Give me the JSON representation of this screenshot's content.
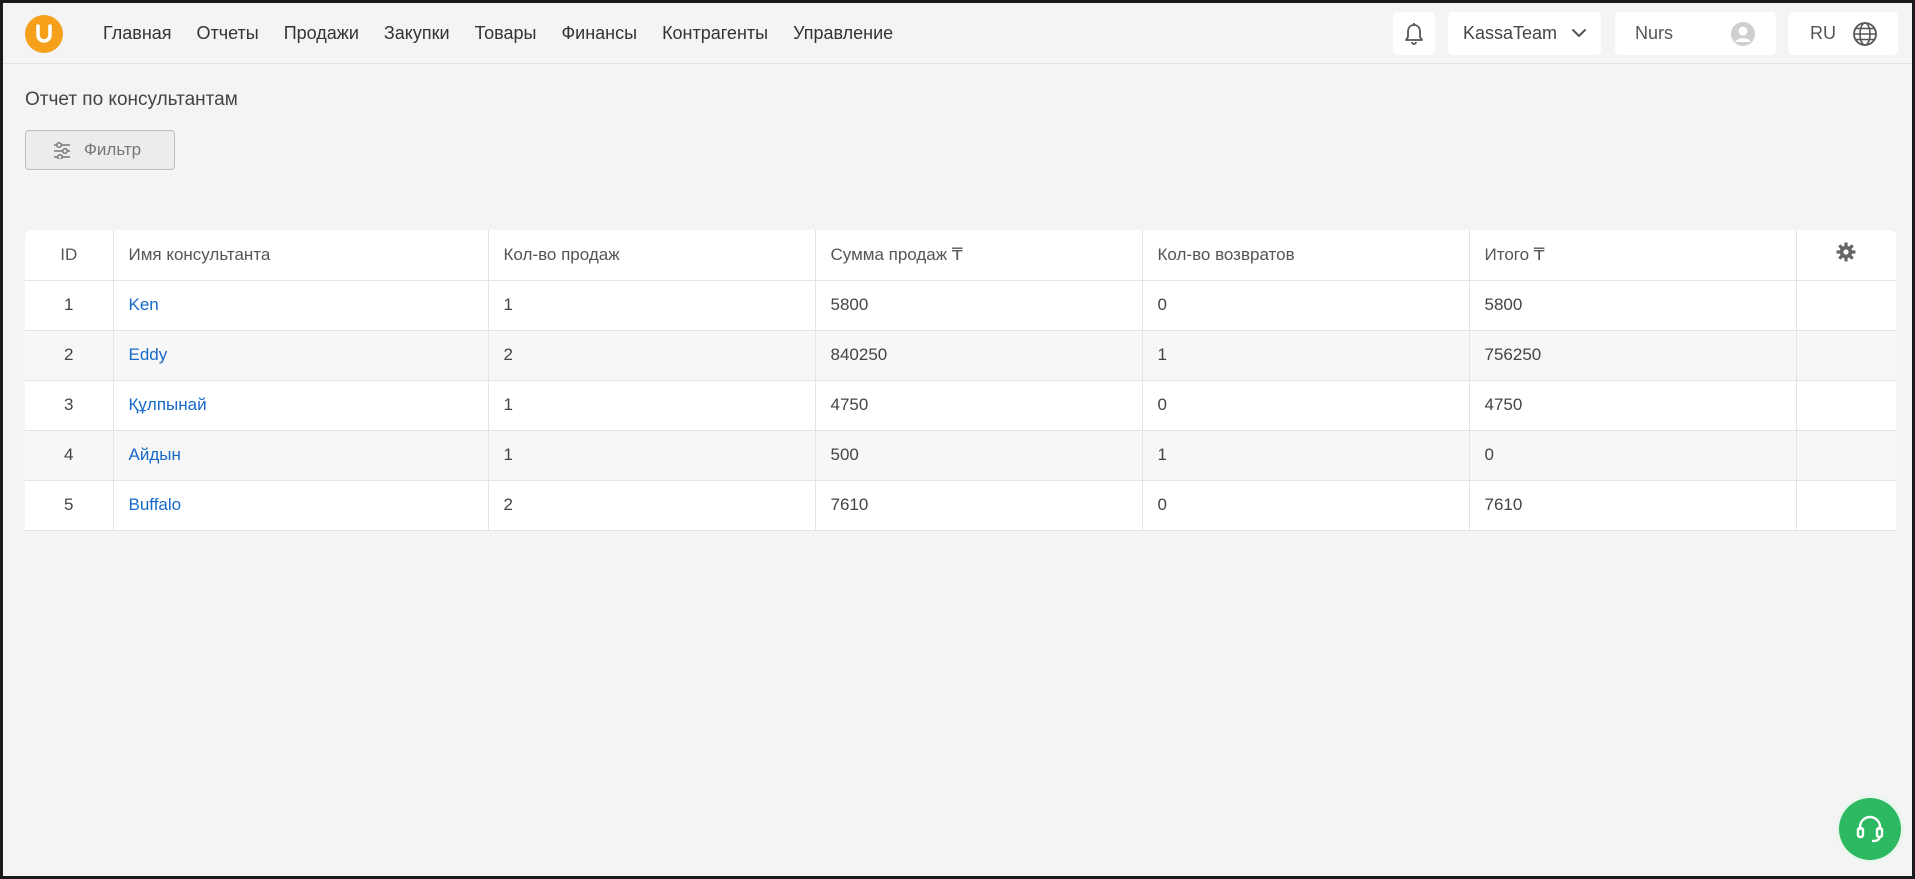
{
  "colors": {
    "accent": "#f6a01a",
    "link": "#1769c9",
    "support": "#2cb961"
  },
  "header": {
    "nav": [
      "Главная",
      "Отчеты",
      "Продажи",
      "Закупки",
      "Товары",
      "Финансы",
      "Контрагенты",
      "Управление"
    ],
    "company": "KassaTeam",
    "user": "Nurs",
    "lang": "RU"
  },
  "page": {
    "title": "Отчет по консультантам",
    "filter_label": "Фильтр"
  },
  "table": {
    "columns": [
      "ID",
      "Имя консультанта",
      "Кол-во продаж",
      "Сумма продаж ₸",
      "Кол-во возвратов",
      "Итого ₸"
    ],
    "rows": [
      [
        "1",
        "Ken",
        "1",
        "5800",
        "0",
        "5800"
      ],
      [
        "2",
        "Eddy",
        "2",
        "840250",
        "1",
        "756250"
      ],
      [
        "3",
        "Құлпынай",
        "1",
        "4750",
        "0",
        "4750"
      ],
      [
        "4",
        "Айдын",
        "1",
        "500",
        "1",
        "0"
      ],
      [
        "5",
        "Buffalo",
        "2",
        "7610",
        "0",
        "7610"
      ]
    ]
  }
}
